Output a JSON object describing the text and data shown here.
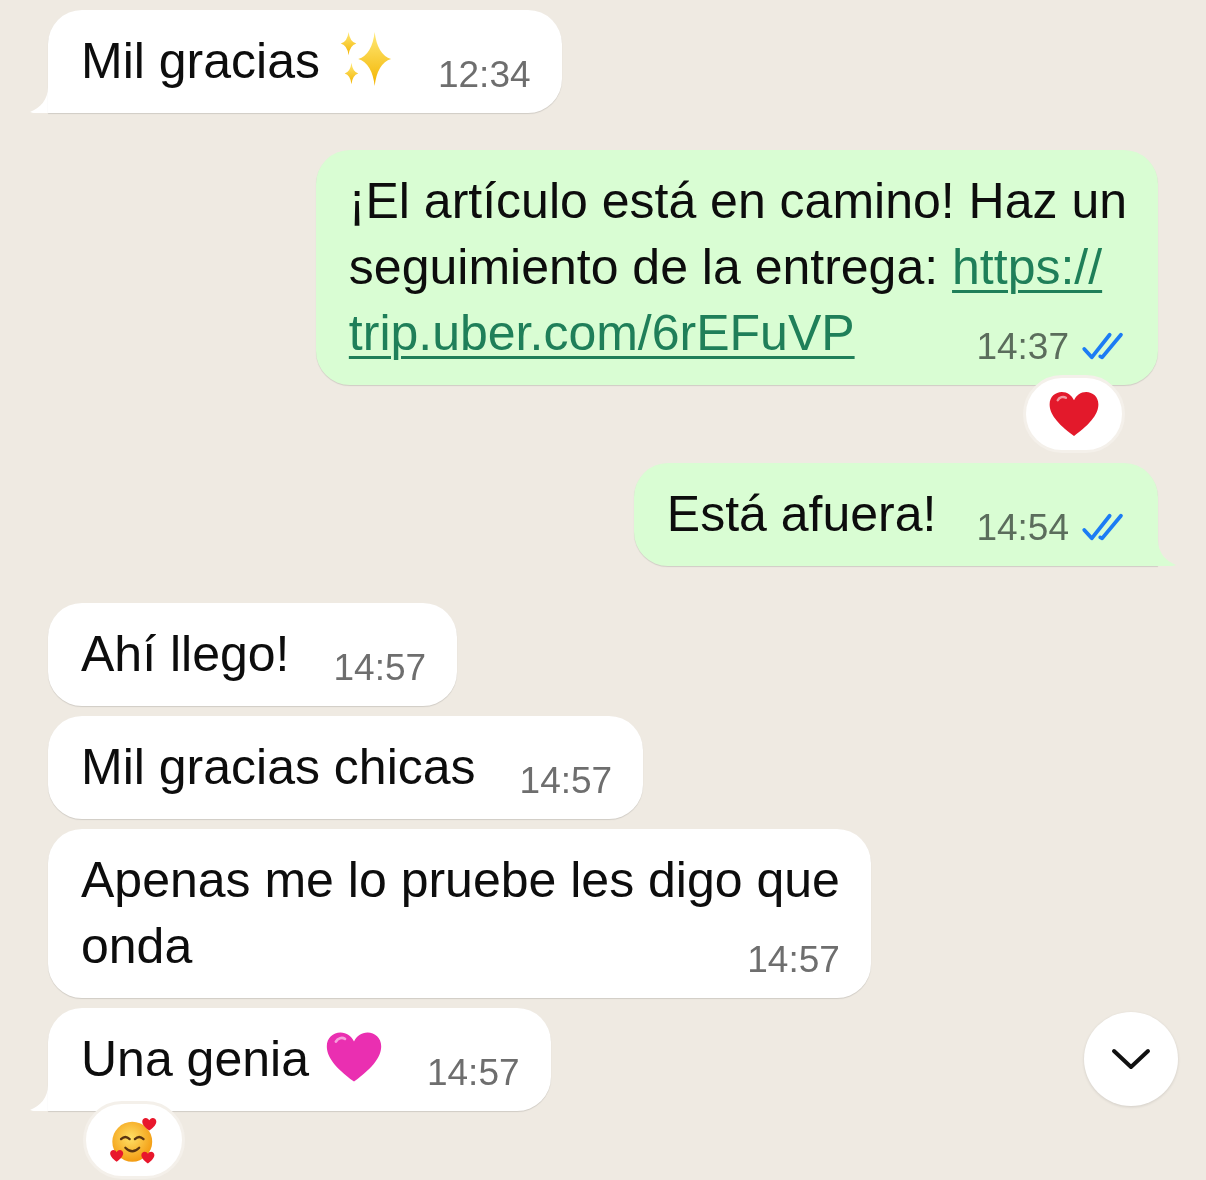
{
  "messages": [
    {
      "kind": "incoming",
      "lines": [
        {
          "text": "Mil gracias",
          "emoji": {
            "kind": "sparkles"
          }
        }
      ],
      "time": "12:34",
      "tail": true
    },
    {
      "kind": "outgoing",
      "lines": [
        {
          "text": "¡El artículo está en camino! Haz un"
        },
        {
          "text": "seguimiento de la entrega:",
          "link": "https://"
        },
        {
          "link": "trip.uber.com/6rEFuVP"
        }
      ],
      "time": "14:37",
      "read": true,
      "tail": false,
      "reaction": {
        "kind": "heart",
        "color": "#e3192b"
      }
    },
    {
      "kind": "outgoing",
      "lines": [
        {
          "text": "Está afuera!"
        }
      ],
      "time": "14:54",
      "read": true,
      "tail": true
    },
    {
      "kind": "incoming",
      "lines": [
        {
          "text": "Ahí llego!"
        }
      ],
      "time": "14:57",
      "tail": false
    },
    {
      "kind": "incoming",
      "lines": [
        {
          "text": "Mil gracias chicas"
        }
      ],
      "time": "14:57",
      "tail": false
    },
    {
      "kind": "incoming",
      "lines": [
        {
          "text": "Apenas me lo pruebe les digo que"
        },
        {
          "text": "onda"
        }
      ],
      "time": "14:57",
      "tail": false
    },
    {
      "kind": "incoming",
      "lines": [
        {
          "text": "Una genia",
          "emoji": {
            "kind": "heart",
            "color": "#ea2fb1"
          }
        }
      ],
      "time": "14:57",
      "tail": true,
      "reaction": {
        "kind": "smiley"
      }
    }
  ]
}
